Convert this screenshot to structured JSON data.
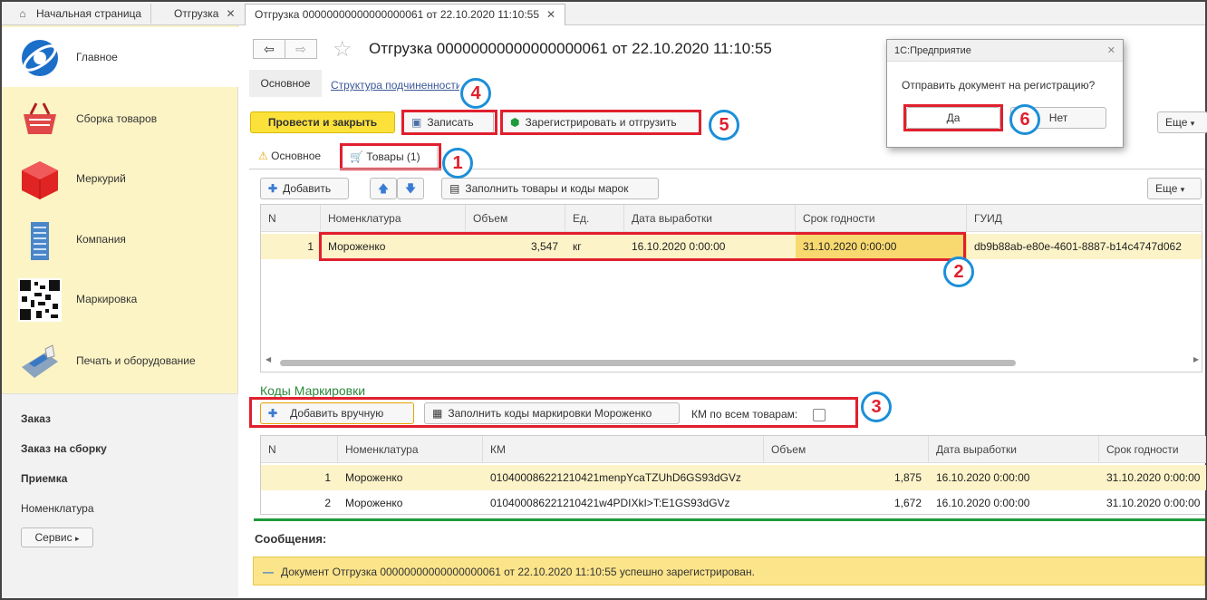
{
  "top_tabs": {
    "home": "Начальная страница",
    "tab2": "Отгрузка",
    "tab3": "Отгрузка 00000000000000000061 от 22.10.2020 11:10:55"
  },
  "sidebar": {
    "items": [
      {
        "label": "Главное"
      },
      {
        "label": "Сборка товаров"
      },
      {
        "label": "Меркурий"
      },
      {
        "label": "Компания"
      },
      {
        "label": "Маркировка"
      },
      {
        "label": "Печать и оборудование"
      }
    ],
    "links": [
      {
        "label": "Заказ"
      },
      {
        "label": "Заказ на сборку"
      },
      {
        "label": "Приемка"
      },
      {
        "label": "Номенклатура"
      }
    ],
    "service_label": "Сервис"
  },
  "document": {
    "title": "Отгрузка 00000000000000000061 от 22.10.2020 11:10:55",
    "subtab_main": "Основное",
    "subtab_structure": "Структура подчиненности"
  },
  "toolbar": {
    "post_close": "Провести и закрыть",
    "save": "Записать",
    "register_ship": "Зарегистрировать и отгрузить",
    "more": "Еще"
  },
  "form_tabs": {
    "main": "Основное",
    "goods": "Товары",
    "goods_count": "(1)"
  },
  "goods_toolbar": {
    "add": "Добавить",
    "fill": "Заполнить товары и коды марок",
    "more": "Еще"
  },
  "goods_table": {
    "headers": [
      "N",
      "Номенклатура",
      "Объем",
      "Ед.",
      "Дата выработки",
      "Срок годности",
      "ГУИД"
    ],
    "rows": [
      {
        "n": "1",
        "name": "Мороженко",
        "volume": "3,547",
        "unit": "кг",
        "made": "16.10.2020 0:00:00",
        "expiry": "31.10.2020 0:00:00",
        "guid": "db9b88ab-e80e-4601-8887-b14c4747d062"
      }
    ]
  },
  "km_section": {
    "title": "Коды Маркировки",
    "add_manual": "Добавить вручную",
    "fill_codes": "Заполнить коды маркировки Мороженко",
    "all_goods": "КМ по всем товарам:",
    "headers": [
      "N",
      "Номенклатура",
      "КМ",
      "Объем",
      "Дата выработки",
      "Срок годности"
    ],
    "rows": [
      {
        "n": "1",
        "name": "Мороженко",
        "km": "010400086221210421menpYcaTZUhD6GS93dGVz",
        "volume": "1,875",
        "made": "16.10.2020 0:00:00",
        "expiry": "31.10.2020 0:00:00"
      },
      {
        "n": "2",
        "name": "Мороженко",
        "km": "010400086221210421w4PDIXkI>T:E1GS93dGVz",
        "volume": "1,672",
        "made": "16.10.2020 0:00:00",
        "expiry": "31.10.2020 0:00:00"
      }
    ]
  },
  "messages": {
    "title": "Сообщения:",
    "text": "Документ Отгрузка 00000000000000000061 от 22.10.2020 11:10:55 успешно зарегистрирован."
  },
  "dialog": {
    "title": "1С:Предприятие",
    "question": "Отправить документ на регистрацию?",
    "yes": "Да",
    "no": "Нет"
  },
  "callouts": [
    "1",
    "2",
    "3",
    "4",
    "5",
    "6"
  ],
  "colors": {
    "annotation_red": "#e0202e",
    "annotation_blue": "#1c8fd8",
    "sidebar_yellow": "#fcf4c5",
    "accent_yellow": "#fce13a"
  }
}
